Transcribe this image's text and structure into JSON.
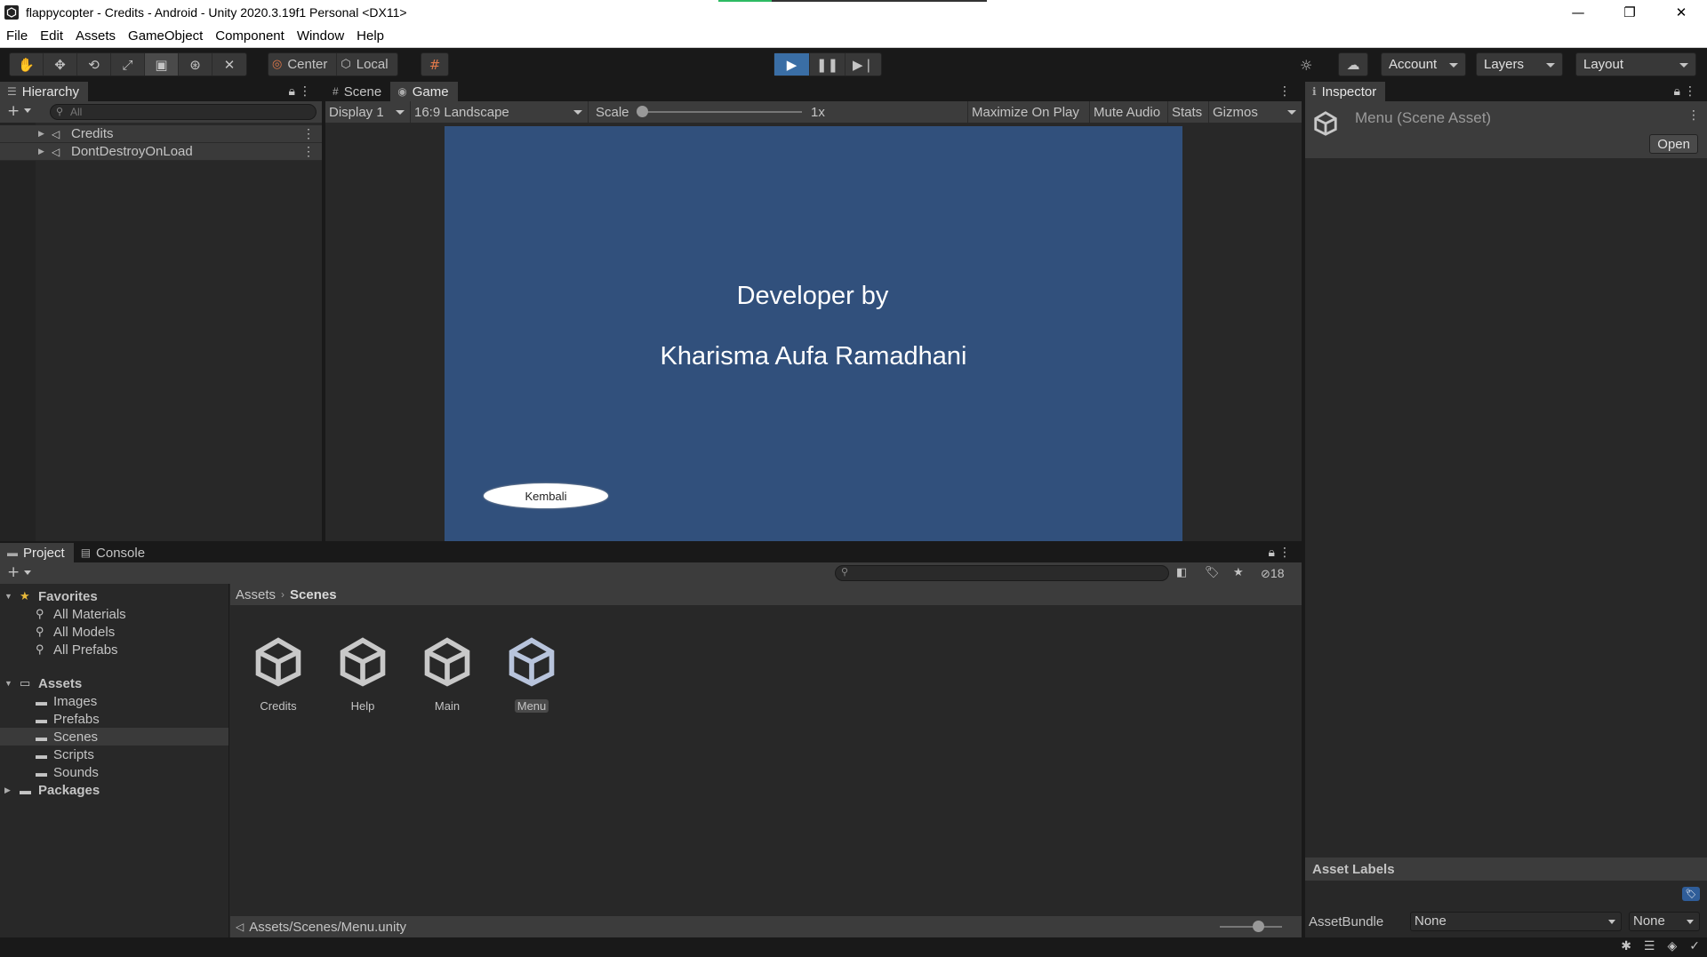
{
  "window": {
    "title": "flappycopter - Credits - Android - Unity 2020.3.19f1 Personal <DX11>",
    "progress": 0.2,
    "minimize": "—",
    "maximize": "❐",
    "close": "✕"
  },
  "menu": [
    "File",
    "Edit",
    "Assets",
    "GameObject",
    "Component",
    "Window",
    "Help"
  ],
  "toolbar": {
    "tools": [
      "hand-tool-icon",
      "move-tool-icon",
      "rotate-tool-icon",
      "scale-tool-icon",
      "rect-tool-icon",
      "transform-tool-icon",
      "custom-tool-icon"
    ],
    "pivot_label": "Center",
    "space_label": "Local",
    "account_label": "Account",
    "layers_label": "Layers",
    "layout_label": "Layout"
  },
  "hierarchy": {
    "tab": "Hierarchy",
    "search_placeholder": "All",
    "items": [
      {
        "label": "Credits"
      },
      {
        "label": "DontDestroyOnLoad"
      }
    ]
  },
  "gameview": {
    "tabs": [
      "Scene",
      "Game"
    ],
    "display": "Display 1",
    "aspect": "16:9 Landscape",
    "scale_label": "Scale",
    "scale_value": "1x",
    "maximize_on_play": "Maximize On Play",
    "mute_audio": "Mute Audio",
    "stats": "Stats",
    "gizmos": "Gizmos",
    "canvas_color": "#31507c",
    "text_line1": "Developer by",
    "text_line2": "Kharisma Aufa Ramadhani",
    "button_label": "Kembali"
  },
  "inspector": {
    "tab": "Inspector",
    "object_name": "Menu (Scene Asset)",
    "open_button": "Open",
    "asset_labels": "Asset Labels",
    "assetbundle_label": "AssetBundle",
    "assetbundle_value": "None",
    "variant_value": "None"
  },
  "project": {
    "tabs": [
      "Project",
      "Console"
    ],
    "hidden_count": "18",
    "favorites_label": "Favorites",
    "favorites": [
      "All Materials",
      "All Models",
      "All Prefabs"
    ],
    "assets_label": "Assets",
    "asset_folders": [
      "Images",
      "Prefabs",
      "Scenes",
      "Scripts",
      "Sounds"
    ],
    "packages_label": "Packages",
    "breadcrumb": [
      "Assets",
      "Scenes"
    ],
    "scene_assets": [
      "Credits",
      "Help",
      "Main",
      "Menu"
    ],
    "selected_path": "Assets/Scenes/Menu.unity"
  },
  "colors": {
    "accent": "#3a6ea5",
    "panel": "#282828",
    "header": "#3c3c3c"
  }
}
